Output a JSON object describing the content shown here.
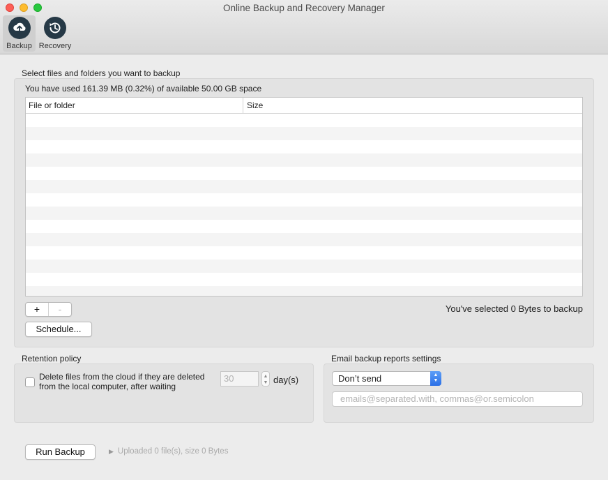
{
  "window": {
    "title": "Online Backup and Recovery Manager"
  },
  "toolbar": {
    "items": [
      {
        "label": "Backup",
        "icon": "cloud-upload-icon",
        "active": true
      },
      {
        "label": "Recovery",
        "icon": "history-icon",
        "active": false
      }
    ]
  },
  "backup": {
    "section_label": "Select files and folders you want to backup",
    "usage_text": "You have used 161.39 MB (0.32%) of available 50.00 GB space",
    "table": {
      "columns": [
        "File or folder",
        "Size"
      ],
      "rows": []
    },
    "add_label": "+",
    "remove_label": "-",
    "selected_text": "You've selected 0 Bytes to backup",
    "schedule_label": "Schedule..."
  },
  "retention": {
    "section_label": "Retention policy",
    "checkbox_label": "Delete files from the cloud if they are deleted from the local computer, after waiting",
    "checked": false,
    "days_placeholder": "30",
    "days_label": "day(s)"
  },
  "email": {
    "section_label": "Email backup reports settings",
    "select_value": "Don’t send",
    "input_placeholder": "emails@separated.with, commas@or.semicolon"
  },
  "footer": {
    "run_label": "Run Backup",
    "upload_status": "Uploaded 0 file(s), size 0 Bytes"
  },
  "colors": {
    "accent": "#2a6fe6",
    "icon_bg": "#263946"
  }
}
